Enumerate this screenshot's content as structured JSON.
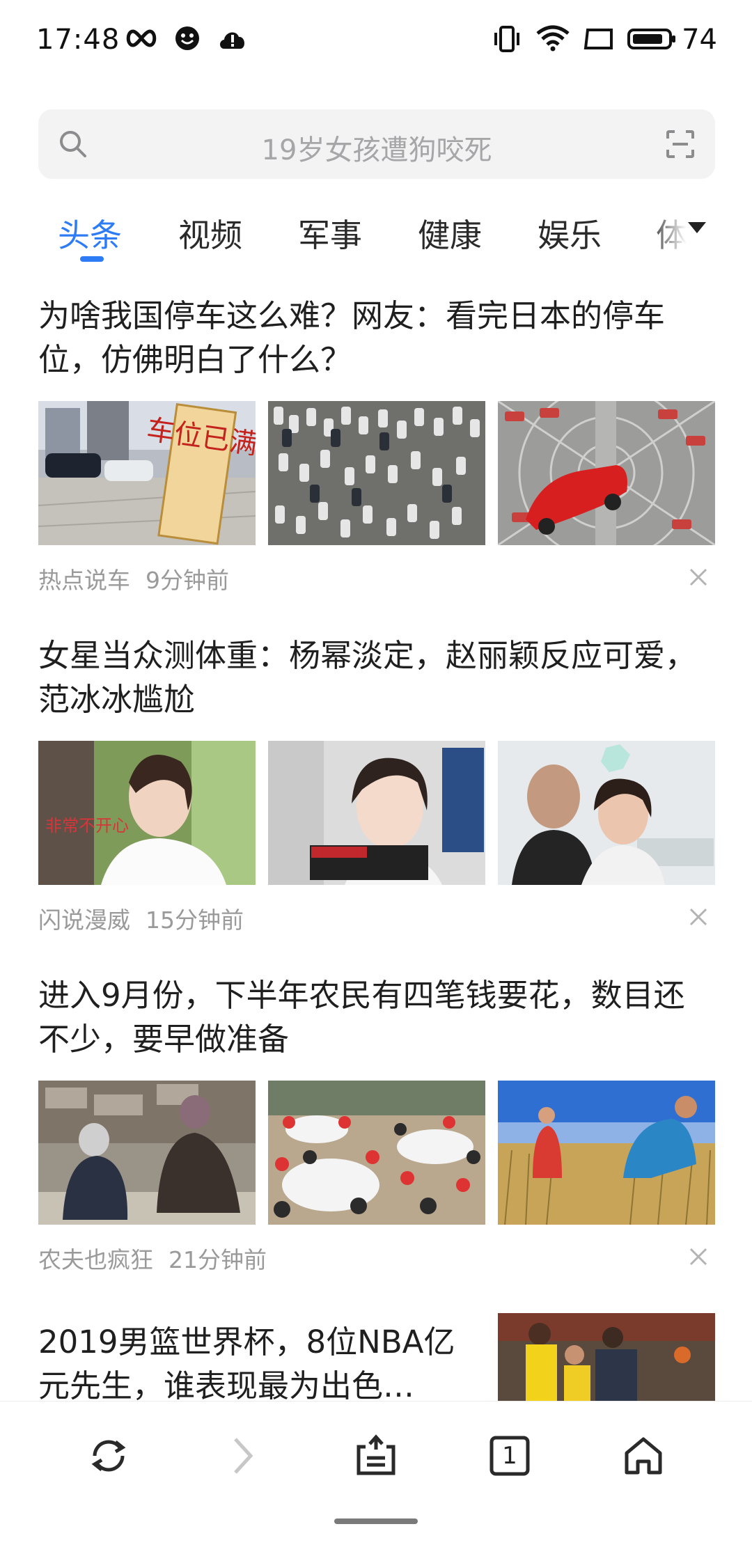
{
  "status": {
    "time": "17:48",
    "battery": "74",
    "icons": [
      "infinity-icon",
      "smiley-icon",
      "cloud-alert-icon",
      "vibrate-icon",
      "wifi-icon",
      "screen-icon",
      "battery-icon"
    ]
  },
  "search": {
    "placeholder": "19岁女孩遭狗咬死"
  },
  "tabs": [
    {
      "label": "头条",
      "active": true
    },
    {
      "label": "视频"
    },
    {
      "label": "军事"
    },
    {
      "label": "健康"
    },
    {
      "label": "娱乐"
    },
    {
      "label": "体"
    }
  ],
  "articles": [
    {
      "title": "为啥我国停车这么难？网友：看完日本的停车位，仿佛明白了什么？",
      "source": "热点说车",
      "time": "9分钟前"
    },
    {
      "title": "女星当众测体重：杨幂淡定，赵丽颖反应可爱，范冰冰尴尬",
      "source": "闪说漫威",
      "time": "15分钟前"
    },
    {
      "title": "进入9月份，下半年农民有四笔钱要花，数目还不少，要早做准备",
      "source": "农夫也疯狂",
      "time": "21分钟前"
    },
    {
      "title": "2019男篮世界杯，8位NBA亿元先生，谁表现最为出色…"
    }
  ],
  "thumb_texts": {
    "parking_sign": "车位已满",
    "weight_overlay": "非常不开心"
  },
  "bottom_nav": {
    "refresh": "refresh-icon",
    "forward": "forward-icon",
    "share": "share-icon",
    "tabs_count": "1",
    "home": "home-icon"
  },
  "colors": {
    "accent": "#2d7cf6",
    "meta": "#9a9a9a",
    "search_bg": "#f3f3f4"
  }
}
